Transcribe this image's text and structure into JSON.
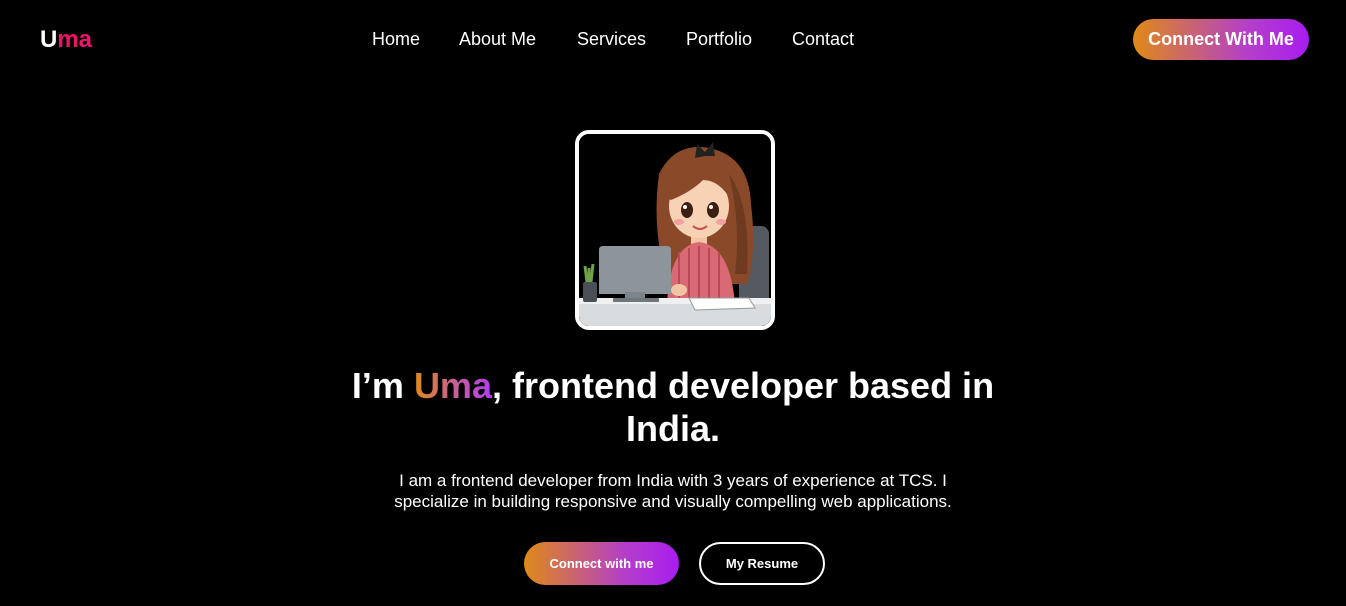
{
  "header": {
    "logo_first": "U",
    "logo_rest": "ma",
    "nav": [
      {
        "label": "Home"
      },
      {
        "label": "About Me"
      },
      {
        "label": "Services"
      },
      {
        "label": "Portfolio"
      },
      {
        "label": "Contact"
      }
    ],
    "cta_label": "Connect With Me"
  },
  "hero": {
    "avatar_icon": "girl-at-laptop-illustration",
    "headline_pre": "I’m ",
    "headline_name": "Uma",
    "headline_post": ", frontend developer based in India.",
    "bio": "I am a frontend developer from India with 3 years of experience at TCS. I specialize in building responsive and visually compelling web applications.",
    "primary_button": "Connect with me",
    "secondary_button": "My Resume"
  },
  "colors": {
    "background": "#000000",
    "logo_accent": "#f0136b",
    "gradient_start": "#df8a17",
    "gradient_end": "#a81cf0"
  }
}
